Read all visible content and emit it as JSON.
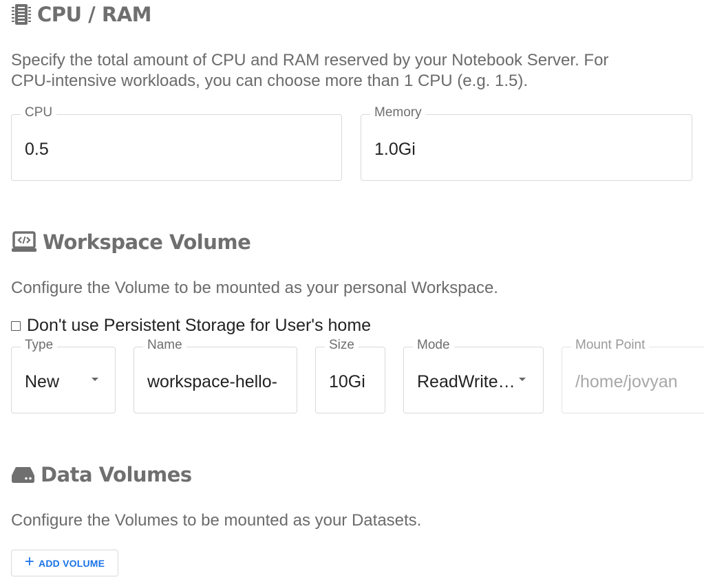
{
  "cpu_ram": {
    "title": "CPU / RAM",
    "icon": "chip-icon",
    "description_line1": "Specify the total amount of CPU and RAM reserved by your Notebook Server. For",
    "description_line2": "CPU-intensive workloads, you can choose more than 1 CPU (e.g. 1.5).",
    "cpu": {
      "label": "CPU",
      "value": "0.5"
    },
    "memory": {
      "label": "Memory",
      "value": "1.0Gi"
    }
  },
  "workspace": {
    "title": "Workspace Volume",
    "icon": "laptop-code-icon",
    "description": "Configure the Volume to be mounted as your personal Workspace.",
    "checkbox_label": "Don't use Persistent Storage for User's home",
    "checkbox_checked": false,
    "type": {
      "label": "Type",
      "value": "New"
    },
    "name": {
      "label": "Name",
      "value": "workspace-hello-"
    },
    "size": {
      "label": "Size",
      "value": "10Gi"
    },
    "mode": {
      "label": "Mode",
      "value": "ReadWrite…"
    },
    "mount_point": {
      "label": "Mount Point",
      "value": "/home/jovyan"
    }
  },
  "data_volumes": {
    "title": "Data Volumes",
    "icon": "hard-drive-icon",
    "description": "Configure the Volumes to be mounted as your Datasets.",
    "add_button_label": "ADD VOLUME"
  },
  "colors": {
    "accent": "#1a73e8",
    "heading": "#6f6f6f",
    "border": "#d9d9d9"
  }
}
